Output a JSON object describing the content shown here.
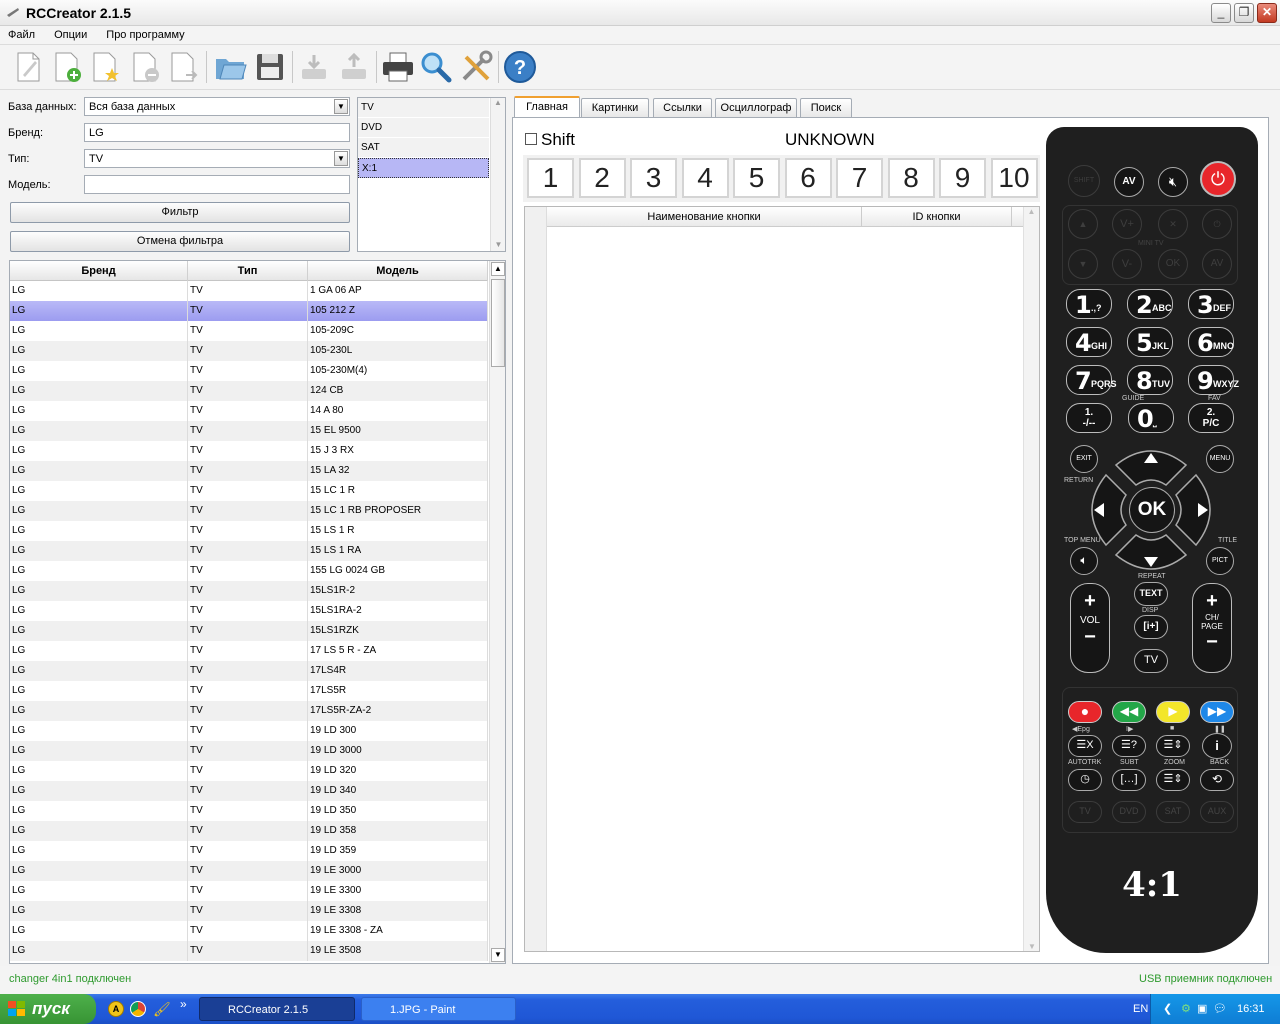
{
  "window": {
    "title": "RCCreator 2.1.5"
  },
  "menu": {
    "items": [
      "Файл",
      "Опции",
      "Про программу"
    ]
  },
  "toolbar": {
    "icons": [
      "new-doc-icon",
      "add-doc-icon",
      "favorite-doc-icon",
      "remove-doc-icon",
      "import-doc-icon",
      "open-folder-icon",
      "save-icon",
      "download-icon",
      "upload-icon",
      "print-icon",
      "search-icon",
      "settings-tools-icon",
      "help-icon"
    ]
  },
  "filter": {
    "db_label": "База данных:",
    "db_value": "Вся база данных",
    "brand_label": "Бренд:",
    "brand_value": "LG",
    "type_label": "Тип:",
    "type_value": "TV",
    "model_label": "Модель:",
    "model_value": "",
    "filter_button": "Фильтр",
    "cancel_button": "Отмена фильтра"
  },
  "type_list": [
    "TV",
    "DVD",
    "SAT",
    "X:1"
  ],
  "type_list_selected": 3,
  "grid": {
    "headers": [
      "Бренд",
      "Тип",
      "Модель"
    ],
    "selected_index": 1,
    "rows": [
      [
        "LG",
        "TV",
        "1 GA 06 AP"
      ],
      [
        "LG",
        "TV",
        "105 212 Z"
      ],
      [
        "LG",
        "TV",
        "105-209C"
      ],
      [
        "LG",
        "TV",
        "105-230L"
      ],
      [
        "LG",
        "TV",
        "105-230M(4)"
      ],
      [
        "LG",
        "TV",
        "124 CB"
      ],
      [
        "LG",
        "TV",
        "14 A 80"
      ],
      [
        "LG",
        "TV",
        "15 EL 9500"
      ],
      [
        "LG",
        "TV",
        "15 J 3 RX"
      ],
      [
        "LG",
        "TV",
        "15 LA 32"
      ],
      [
        "LG",
        "TV",
        "15 LC 1 R"
      ],
      [
        "LG",
        "TV",
        "15 LC 1 RB PROPOSER"
      ],
      [
        "LG",
        "TV",
        "15 LS 1 R"
      ],
      [
        "LG",
        "TV",
        "15 LS 1 RA"
      ],
      [
        "LG",
        "TV",
        "155 LG 0024 GB"
      ],
      [
        "LG",
        "TV",
        "15LS1R-2"
      ],
      [
        "LG",
        "TV",
        "15LS1RA-2"
      ],
      [
        "LG",
        "TV",
        "15LS1RZK"
      ],
      [
        "LG",
        "TV",
        "17 LS 5 R - ZA"
      ],
      [
        "LG",
        "TV",
        "17LS4R"
      ],
      [
        "LG",
        "TV",
        "17LS5R"
      ],
      [
        "LG",
        "TV",
        "17LS5R-ZA-2"
      ],
      [
        "LG",
        "TV",
        "19 LD 300"
      ],
      [
        "LG",
        "TV",
        "19 LD 3000"
      ],
      [
        "LG",
        "TV",
        "19 LD 320"
      ],
      [
        "LG",
        "TV",
        "19 LD 340"
      ],
      [
        "LG",
        "TV",
        "19 LD 350"
      ],
      [
        "LG",
        "TV",
        "19 LD 358"
      ],
      [
        "LG",
        "TV",
        "19 LD 359"
      ],
      [
        "LG",
        "TV",
        "19 LE 3000"
      ],
      [
        "LG",
        "TV",
        "19 LE 3300"
      ],
      [
        "LG",
        "TV",
        "19 LE 3308"
      ],
      [
        "LG",
        "TV",
        "19 LE 3308 - ZA"
      ],
      [
        "LG",
        "TV",
        "19 LE 3508"
      ]
    ]
  },
  "tabs": [
    "Главная",
    "Картинки",
    "Ссылки",
    "Осциллограф",
    "Поиск"
  ],
  "main_tab": {
    "shift_label": "Shift",
    "device_name": "UNKNOWN",
    "number_buttons": [
      "1",
      "2",
      "3",
      "4",
      "5",
      "6",
      "7",
      "8",
      "9",
      "10"
    ],
    "table_headers": [
      "Наименование кнопки",
      "ID кнопки"
    ]
  },
  "remote": {
    "top_keys": [
      "SHIFT",
      "AV"
    ],
    "nav_ghost": [
      "V+",
      "V-",
      "OK",
      "AV"
    ],
    "mini_label": "MINI TV",
    "digits": [
      {
        "d": "1",
        "s": ".,?"
      },
      {
        "d": "2",
        "s": "ABC"
      },
      {
        "d": "3",
        "s": "DEF"
      },
      {
        "d": "4",
        "s": "GHI"
      },
      {
        "d": "5",
        "s": "JKL"
      },
      {
        "d": "6",
        "s": "MNO"
      },
      {
        "d": "7",
        "s": "PQRS"
      },
      {
        "d": "8",
        "s": "TUV"
      },
      {
        "d": "9",
        "s": "WXYZ"
      }
    ],
    "guide": "GUIDE",
    "fav": "FAV",
    "k_dash": "1.\n-/--",
    "k_zero": "0",
    "k_pc": "2.\nP/C",
    "exit": "EXIT",
    "menu": "MENU",
    "return": "RETURN",
    "ok": "OK",
    "top_menu": "TOP MENU",
    "title": "TITLE",
    "pict": "PICT",
    "repeat": "REPEAT",
    "text": "TEXT",
    "disp": "DISP",
    "tv": "TV",
    "vol": "VOL",
    "ch": "CH/\nPAGE",
    "epg": "◀Epg",
    "autotrk": "AUTOTRK",
    "subt": "SUBT",
    "zoom": "ZOOM",
    "back": "BACK",
    "modes": [
      "TV",
      "DVD",
      "SAT",
      "AUX"
    ],
    "logo": "4:1",
    "colors": {
      "red": "#e8262b",
      "green": "#23a648",
      "yellow": "#f3e62a",
      "blue": "#1f88e8",
      "power": "#e8262b"
    }
  },
  "status": {
    "left": "changer 4in1 подключен",
    "right": "USB приемник подключен",
    "color": "#2e9a2e"
  },
  "taskbar": {
    "start": "пуск",
    "tasks": [
      "RCCreator 2.1.5",
      "1.JPG - Paint"
    ],
    "lang": "EN",
    "clock": "16:31"
  }
}
